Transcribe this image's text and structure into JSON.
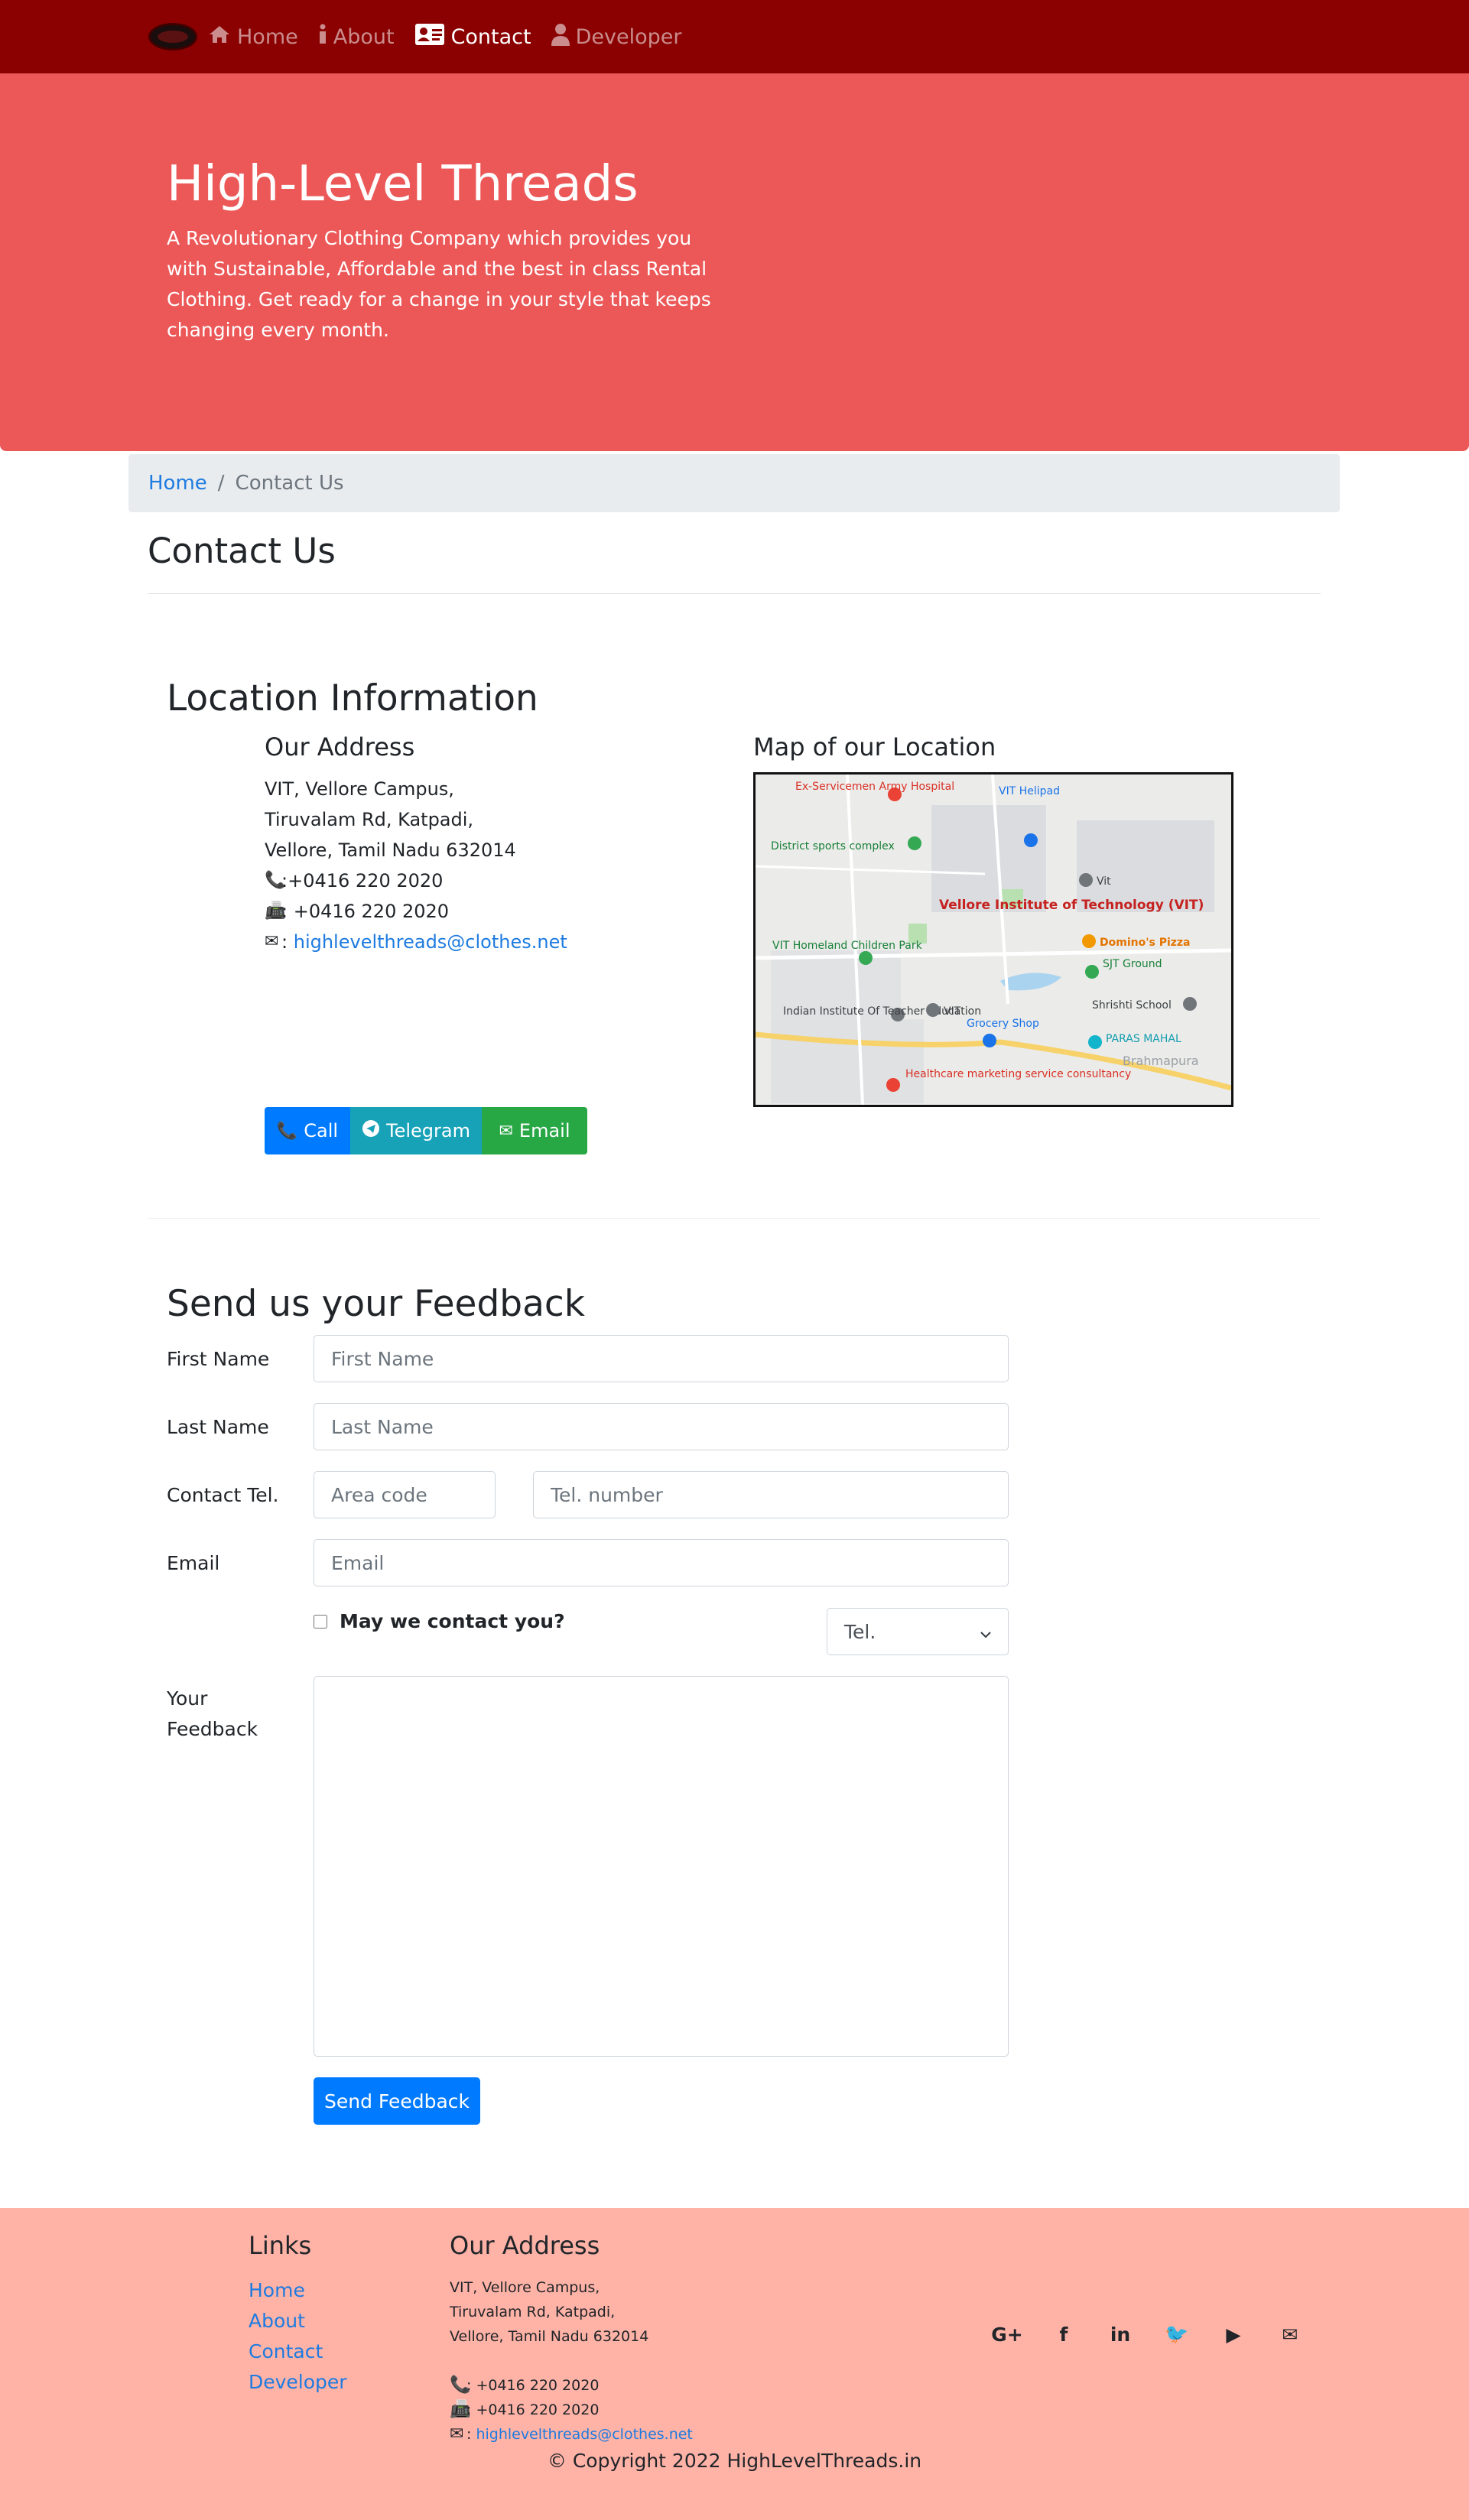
{
  "nav": {
    "items": [
      {
        "label": "Home",
        "icon": "home-icon",
        "glyph": "🏠",
        "active": false
      },
      {
        "label": "About",
        "icon": "info-icon",
        "glyph": "ℹ",
        "active": false
      },
      {
        "label": "Contact",
        "icon": "address-card-icon",
        "glyph": "▣",
        "active": true
      },
      {
        "label": "Developer",
        "icon": "user-icon",
        "glyph": "👤",
        "active": false
      }
    ]
  },
  "jumbotron": {
    "title": "High-Level Threads",
    "text": "A Revolutionary Clothing Company which provides you with Sustainable, Affordable and the best in class Rental Clothing. Get ready for a change in your style that keeps changing every month."
  },
  "breadcrumb": {
    "home": "Home",
    "separator": "/",
    "current": "Contact Us"
  },
  "page_title": "Contact Us",
  "location": {
    "title": "Location Information",
    "address_title": "Our Address",
    "address_lines": [
      "VIT, Vellore Campus,",
      "Tiruvalam Rd, Katpadi,",
      "Vellore, Tamil Nadu 632014"
    ],
    "phone": ":+0416 220 2020",
    "fax": ": +0416 220 2020",
    "email_prefix": ": ",
    "email": "highlevelthreads@clothes.net",
    "map_title": "Map of our Location",
    "map_labels": {
      "hospital": "Ex-Servicemen Army Hospital",
      "helipad": "VIT Helipad",
      "sports": "District sports complex",
      "vit_pin": "Vit",
      "vit_title": "Vellore Institute of Technology (VIT)",
      "dominos": "Domino's Pizza",
      "homeland": "VIT Homeland Children Park",
      "sjt": "SJT Ground",
      "shrishti": "Shrishti School",
      "iite": "Indian Institute Of Teacher Education",
      "vit2": "VIT",
      "grocery": "Grocery Shop",
      "paras": "PARAS MAHAL",
      "healthcare": "Healthcare marketing service consultancy",
      "brahma": "Brahmapura"
    },
    "buttons": {
      "call": "Call",
      "telegram": "Telegram",
      "email": "Email"
    }
  },
  "feedback": {
    "title": "Send us your Feedback",
    "first_name_label": "First Name",
    "first_name_placeholder": "First Name",
    "last_name_label": "Last Name",
    "last_name_placeholder": "Last Name",
    "tel_label": "Contact Tel.",
    "area_placeholder": "Area code",
    "tel_placeholder": "Tel. number",
    "email_label": "Email",
    "email_placeholder": "Email",
    "contact_check": "May we contact you?",
    "contact_method": "Tel.",
    "feedback_label": "Your Feedback",
    "send": "Send Feedback"
  },
  "footer": {
    "links_title": "Links",
    "links": [
      "Home",
      "About",
      "Contact",
      "Developer"
    ],
    "address_title": "Our Address",
    "address_lines": [
      "VIT, Vellore Campus,",
      "Tiruvalam Rd, Katpadi,",
      "Vellore, Tamil Nadu 632014"
    ],
    "phone": ": +0416 220 2020",
    "fax": ": +0416 220 2020",
    "email_prefix": ": ",
    "email": "highlevelthreads@clothes.net",
    "socials": [
      {
        "name": "google-plus-icon",
        "glyph": "G+"
      },
      {
        "name": "facebook-icon",
        "glyph": "f"
      },
      {
        "name": "linkedin-icon",
        "glyph": "in"
      },
      {
        "name": "twitter-icon",
        "glyph": "🐦"
      },
      {
        "name": "youtube-icon",
        "glyph": "▶"
      },
      {
        "name": "envelope-icon",
        "glyph": "✉"
      }
    ],
    "copyright": "© Copyright 2022 HighLevelThreads.in"
  }
}
